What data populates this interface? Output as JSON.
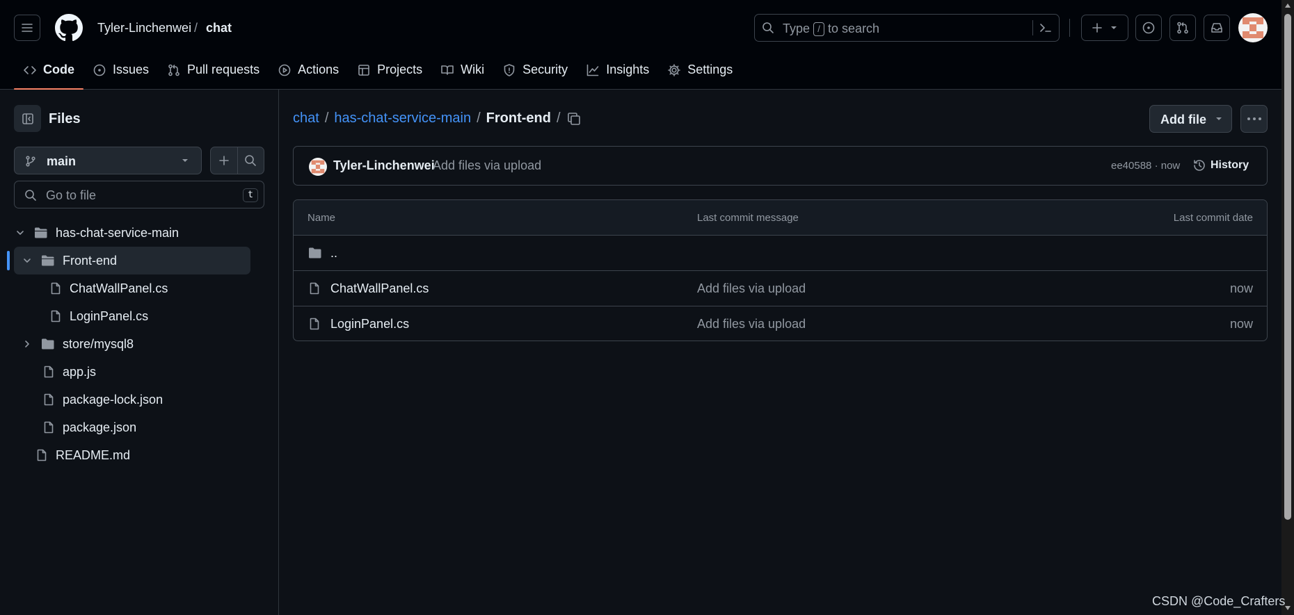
{
  "header": {
    "owner": "Tyler-Linchenwei",
    "separator": "/",
    "repo": "chat",
    "search_prefix": "Type",
    "search_key": "/",
    "search_suffix": "to search"
  },
  "tabs": [
    {
      "label": "Code",
      "icon": "code-icon",
      "active": true
    },
    {
      "label": "Issues",
      "icon": "issue-opened-icon"
    },
    {
      "label": "Pull requests",
      "icon": "git-pull-request-icon"
    },
    {
      "label": "Actions",
      "icon": "play-icon"
    },
    {
      "label": "Projects",
      "icon": "table-icon"
    },
    {
      "label": "Wiki",
      "icon": "book-icon"
    },
    {
      "label": "Security",
      "icon": "shield-icon"
    },
    {
      "label": "Insights",
      "icon": "graph-icon"
    },
    {
      "label": "Settings",
      "icon": "gear-icon"
    }
  ],
  "sidebar": {
    "title": "Files",
    "branch": "main",
    "goto_placeholder": "Go to file",
    "goto_shortcut": "t",
    "tree": [
      {
        "label": "has-chat-service-main",
        "type": "folder",
        "expanded": true
      },
      {
        "label": "Front-end",
        "type": "folder",
        "expanded": true,
        "selected": true
      },
      {
        "label": "ChatWallPanel.cs",
        "type": "file"
      },
      {
        "label": "LoginPanel.cs",
        "type": "file"
      },
      {
        "label": "store/mysql8",
        "type": "folder",
        "expanded": false
      },
      {
        "label": "app.js",
        "type": "file"
      },
      {
        "label": "package-lock.json",
        "type": "file"
      },
      {
        "label": "package.json",
        "type": "file"
      },
      {
        "label": "README.md",
        "type": "file"
      }
    ]
  },
  "path": {
    "repo": "chat",
    "folder": "has-chat-service-main",
    "current": "Front-end",
    "sep": "/"
  },
  "actions": {
    "add_file": "Add file"
  },
  "commit": {
    "author": "Tyler-Linchenwei",
    "message": "Add files via upload",
    "meta": "ee40588 · now",
    "history": "History"
  },
  "table": {
    "headers": [
      "Name",
      "Last commit message",
      "Last commit date"
    ],
    "parent": "..",
    "rows": [
      {
        "name": "ChatWallPanel.cs",
        "message": "Add files via upload",
        "date": "now"
      },
      {
        "name": "LoginPanel.cs",
        "message": "Add files via upload",
        "date": "now"
      }
    ]
  },
  "watermark": "CSDN @Code_Crafters",
  "colors": {
    "background": "#0d1117",
    "header": "#010409",
    "link": "#4493f8",
    "active_tab_underline": "#f78166",
    "muted_text": "#9198a1"
  }
}
